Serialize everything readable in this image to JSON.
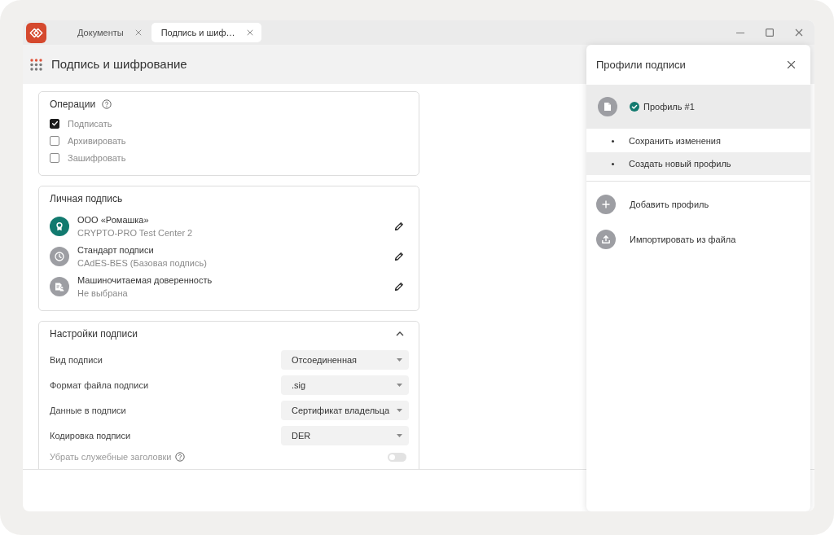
{
  "window": {
    "tabs": [
      {
        "label": "Документы",
        "selected": false
      },
      {
        "label": "Подпись и шиф…",
        "selected": true
      }
    ]
  },
  "header": {
    "title": "Подпись и шифрование"
  },
  "operations": {
    "title": "Операции",
    "items": [
      {
        "label": "Подписать",
        "checked": true
      },
      {
        "label": "Архивировать",
        "checked": false
      },
      {
        "label": "Зашифровать",
        "checked": false
      }
    ]
  },
  "personal_signature": {
    "title": "Личная подпись",
    "items": [
      {
        "kind": "certificate",
        "color": "#127a6f",
        "title": "ООО «Ромашка»",
        "subtitle": "CRYPTO-PRO Test Center 2"
      },
      {
        "kind": "clock",
        "color": "#9d9ea3",
        "title": "Стандарт подписи",
        "subtitle": "CAdES-BES (Базовая подпись)"
      },
      {
        "kind": "power_of_attorney",
        "color": "#9d9ea3",
        "title": "Машиночитаемая доверенность",
        "subtitle": "Не выбрана"
      }
    ]
  },
  "signature_settings": {
    "title": "Настройки подписи",
    "expanded": true,
    "fields": [
      {
        "label": "Вид подписи",
        "value": "Отсоединенная"
      },
      {
        "label": "Формат файла подписи",
        "value": ".sig"
      },
      {
        "label": "Данные в подписи",
        "value": "Сертификат владельца"
      },
      {
        "label": "Кодировка подписи",
        "value": "DER"
      }
    ],
    "toggle": {
      "label": "Убрать служебные заголовки",
      "on": false,
      "disabled": true
    }
  },
  "profiles_panel": {
    "title": "Профили подписи",
    "profiles": [
      {
        "name": "Профиль #1",
        "selected": true,
        "active": true
      }
    ],
    "menu": [
      {
        "label": "Сохранить изменения",
        "highlighted": false
      },
      {
        "label": "Создать новый профиль",
        "highlighted": true
      }
    ],
    "actions": [
      {
        "kind": "add",
        "label": "Добавить профиль"
      },
      {
        "kind": "import",
        "label": "Импортировать из файла"
      }
    ]
  }
}
